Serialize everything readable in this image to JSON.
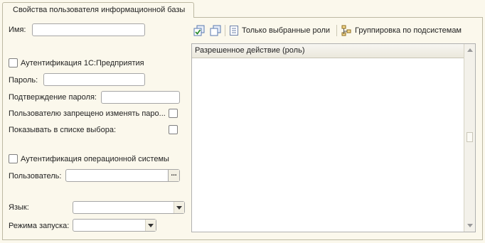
{
  "tab": {
    "title": "Свойства пользователя информационной базы"
  },
  "fields": {
    "name_label": "Имя:",
    "name_value": "",
    "auth1c_label": "Аутентификация 1С:Предприятия",
    "password_label": "Пароль:",
    "password_value": "",
    "confirm_label": "Подтверждение пароля:",
    "confirm_value": "",
    "forbid_label": "Пользователю запрещено изменять паро...",
    "show_label": "Показывать в списке выбора:",
    "os_auth_label": "Аутентификация операционной системы",
    "user_label": "Пользователь:",
    "user_value": "",
    "user_select_button": "...",
    "language_label": "Язык:",
    "language_value": "",
    "launch_label": "Режима запуска:",
    "launch_value": ""
  },
  "toolbar": {
    "only_selected_label": "Только выбранные роли",
    "grouping_label": "Группировка по подсистемам"
  },
  "table": {
    "column_header": "Разрешенное действие (роль)"
  },
  "icons": {
    "check_all": "check-all-icon",
    "uncheck_all": "uncheck-all-icon",
    "only_selected": "document-icon",
    "grouping": "hierarchy-icon"
  }
}
